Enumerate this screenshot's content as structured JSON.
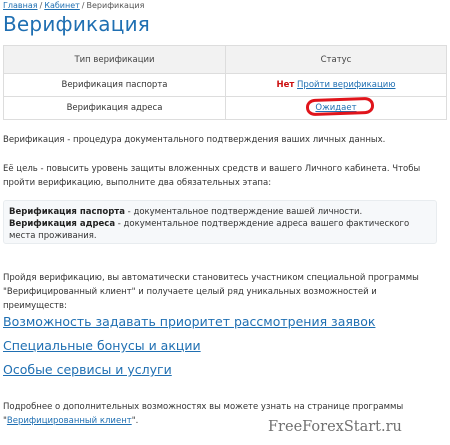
{
  "breadcrumb": {
    "home": "Главная",
    "cabinet": "Кабинет",
    "current": "Верификация",
    "separator": "/"
  },
  "page": {
    "title": "Верификация"
  },
  "table": {
    "headers": [
      "Тип верификации",
      "Статус"
    ],
    "rows": [
      {
        "type": "Верификация паспорта",
        "status": "Нет",
        "action": "Пройти верификацию"
      },
      {
        "type": "Верификация адреса",
        "status_link": "Ожидает"
      }
    ]
  },
  "text": {
    "intro": "Верификация - процедура документального подтверждения ваших личных данных.",
    "goal": "Её цель - повысить уровень защиты вложенных средств и вашего Личного кабинета. Чтобы пройти верификацию, выполните два обязательных этапа:",
    "steps": [
      {
        "title": "Верификация паспорта",
        "desc": " - документальное подтверждение вашей личности."
      },
      {
        "title": "Верификация адреса",
        "desc": " - документальное подтверждение адреса вашего фактического места проживания."
      }
    ],
    "benefits": "Пройдя верификацию, вы автоматически становитесь участником специальной программы \"Верифицированный клиент\" и получаете целый ряд уникальных возможностей и преимуществ:",
    "more_prefix": "Подробнее о дополнительных возможностях вы можете узнать на странице программы \"",
    "more_link": "Верифицированный клиент",
    "more_suffix": "\"."
  },
  "links": [
    "Возможность задавать приоритет рассмотрения заявок",
    "Специальные бонусы и акции",
    "Особые сервисы и услуги"
  ],
  "watermark": "FreeForexStart.ru",
  "colors": {
    "accent": "#1f6fb2",
    "no_status": "#cc1010",
    "highlight_ring": "#e0141b"
  }
}
